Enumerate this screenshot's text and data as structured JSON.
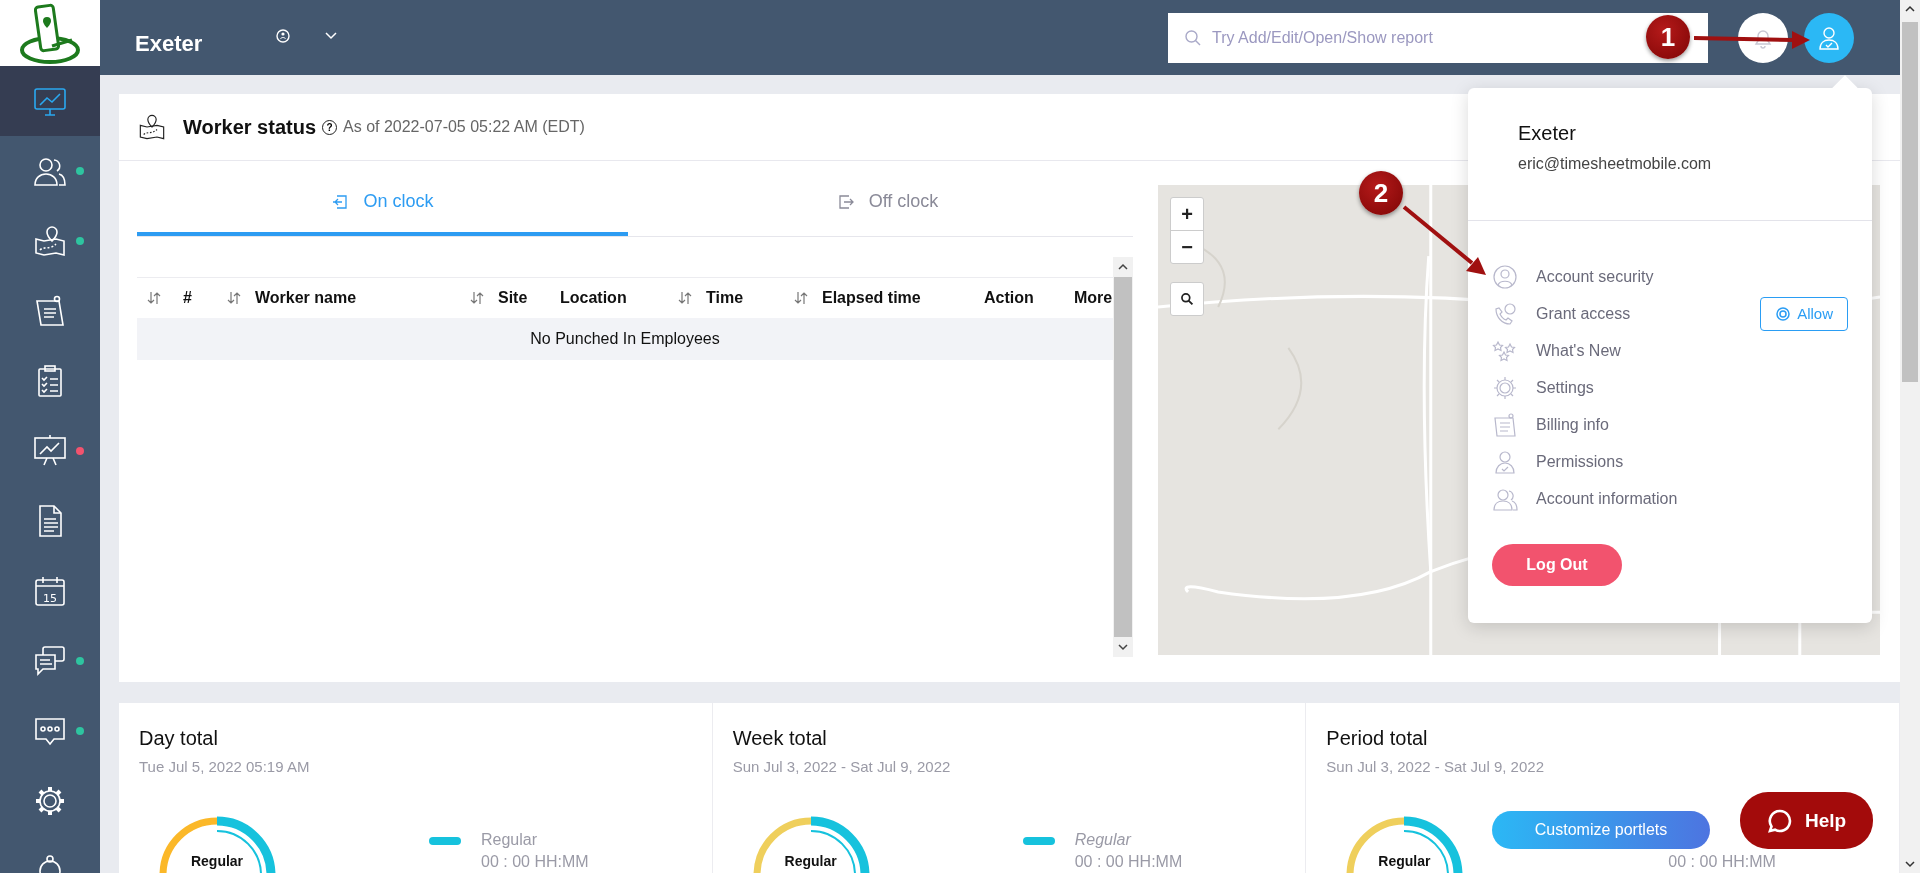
{
  "topbar": {
    "title": "Exeter",
    "search": {
      "placeholder": "Try Add/Edit/Open/Show report"
    }
  },
  "sidebar": {
    "items": [
      {
        "kind": "dashboard",
        "selected": true
      },
      {
        "kind": "workers",
        "selected": false,
        "color": "#2ec4a0"
      },
      {
        "kind": "map",
        "selected": false,
        "color": "#2ec4a0"
      },
      {
        "kind": "notes",
        "selected": false
      },
      {
        "kind": "checklist",
        "selected": false
      },
      {
        "kind": "presentation",
        "selected": false,
        "color": "#f2536e"
      },
      {
        "kind": "document",
        "selected": false
      },
      {
        "kind": "calendar",
        "selected": false,
        "label": "15"
      },
      {
        "kind": "chat",
        "selected": false,
        "color": "#2ec4a0"
      },
      {
        "kind": "message",
        "selected": false,
        "color": "#2ec4a0"
      },
      {
        "kind": "settings",
        "selected": false
      },
      {
        "kind": "cut",
        "selected": false
      }
    ]
  },
  "worker_status": {
    "title": "Worker status",
    "help": "?",
    "as_of": "As of 2022-07-05 05:22 AM (EDT)",
    "tabs": [
      {
        "label": "On clock",
        "kind": "in",
        "selected": true
      },
      {
        "label": "Off clock",
        "kind": "out",
        "selected": false
      }
    ],
    "table": {
      "columns": [
        {
          "label": "#",
          "sortable": true
        },
        {
          "label": "Worker name",
          "sortable": true
        },
        {
          "label": "Site",
          "sortable": true
        },
        {
          "label": "Location",
          "sortable": false
        },
        {
          "label": "Time",
          "sortable": true
        },
        {
          "label": "Elapsed time",
          "sortable": true
        },
        {
          "label": "Action",
          "sortable": false
        },
        {
          "label": "More",
          "sortable": false
        }
      ],
      "empty_message": "No Punched In Employees"
    },
    "map": {
      "zoom_in": "+",
      "zoom_out": "−"
    }
  },
  "user_menu": {
    "name": "Exeter",
    "email": "eric@timesheetmobile.com",
    "items": [
      {
        "label": "Account security",
        "kind": "security"
      },
      {
        "label": "Grant access",
        "kind": "access",
        "action": "Allow"
      },
      {
        "label": "What's New",
        "kind": "news"
      },
      {
        "label": "Settings",
        "kind": "settings"
      },
      {
        "label": "Billing info",
        "kind": "billing"
      },
      {
        "label": "Permissions",
        "kind": "permissions"
      },
      {
        "label": "Account information",
        "kind": "account"
      }
    ],
    "logout": "Log Out"
  },
  "portlets": [
    {
      "title": "Day total",
      "subtitle": "Tue Jul 5, 2022 05:19 AM",
      "color": "#fbb829",
      "donut_label": "Regular",
      "legend": {
        "label": "Regular",
        "italic": false,
        "value": "00 : 00 HH:MM"
      }
    },
    {
      "title": "Week total",
      "subtitle": "Sun Jul 3, 2022 - Sat Jul 9, 2022",
      "color": "#efcf5c",
      "donut_label": "Regular",
      "legend": {
        "label": "Regular",
        "italic": true,
        "value": "00 : 00 HH:MM"
      }
    },
    {
      "title": "Period total",
      "subtitle": "Sun Jul 3, 2022 - Sat Jul 9, 2022",
      "color": "#efcf5c",
      "donut_label": "Regular",
      "legend": {
        "value": "00 : 00 HH:MM"
      }
    }
  ],
  "customize_button": "Customize portlets",
  "help_button": "Help",
  "annotations": [
    {
      "label": "1"
    },
    {
      "label": "2"
    }
  ]
}
